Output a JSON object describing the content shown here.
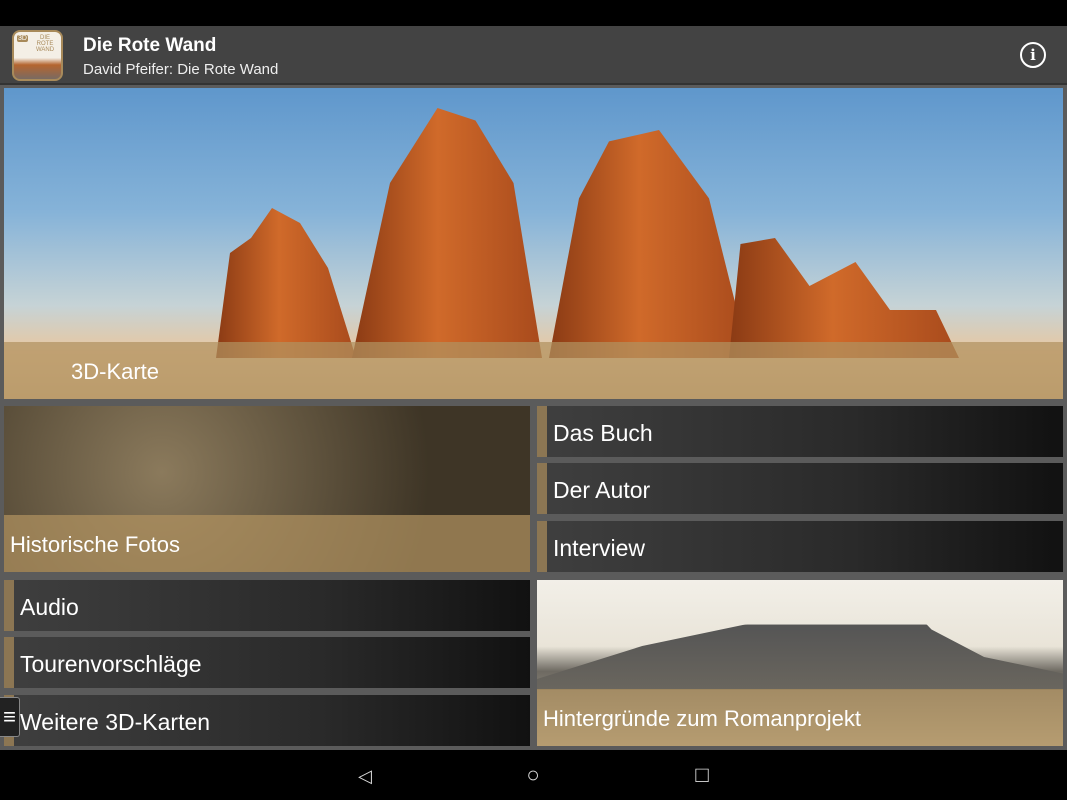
{
  "app": {
    "title": "Die Rote Wand",
    "subtitle": "David Pfeifer: Die Rote Wand",
    "icon_label_3d": "3D",
    "icon_label_title": "DIE ROTE WAND",
    "info_icon": "info-icon"
  },
  "tiles": {
    "hero": "3D-Karte",
    "historic_photos": "Historische Fotos",
    "background": "Hintergründe zum Romanprojekt"
  },
  "menu": [
    "Das Buch",
    "Der Autor",
    "Interview",
    "Audio",
    "Tourenvorschläge",
    "Weitere 3D-Karten"
  ],
  "colors": {
    "accent": "#8c7653",
    "appbar": "#434343"
  },
  "nav": {
    "back": "◁",
    "home": "○",
    "recents": "□"
  }
}
